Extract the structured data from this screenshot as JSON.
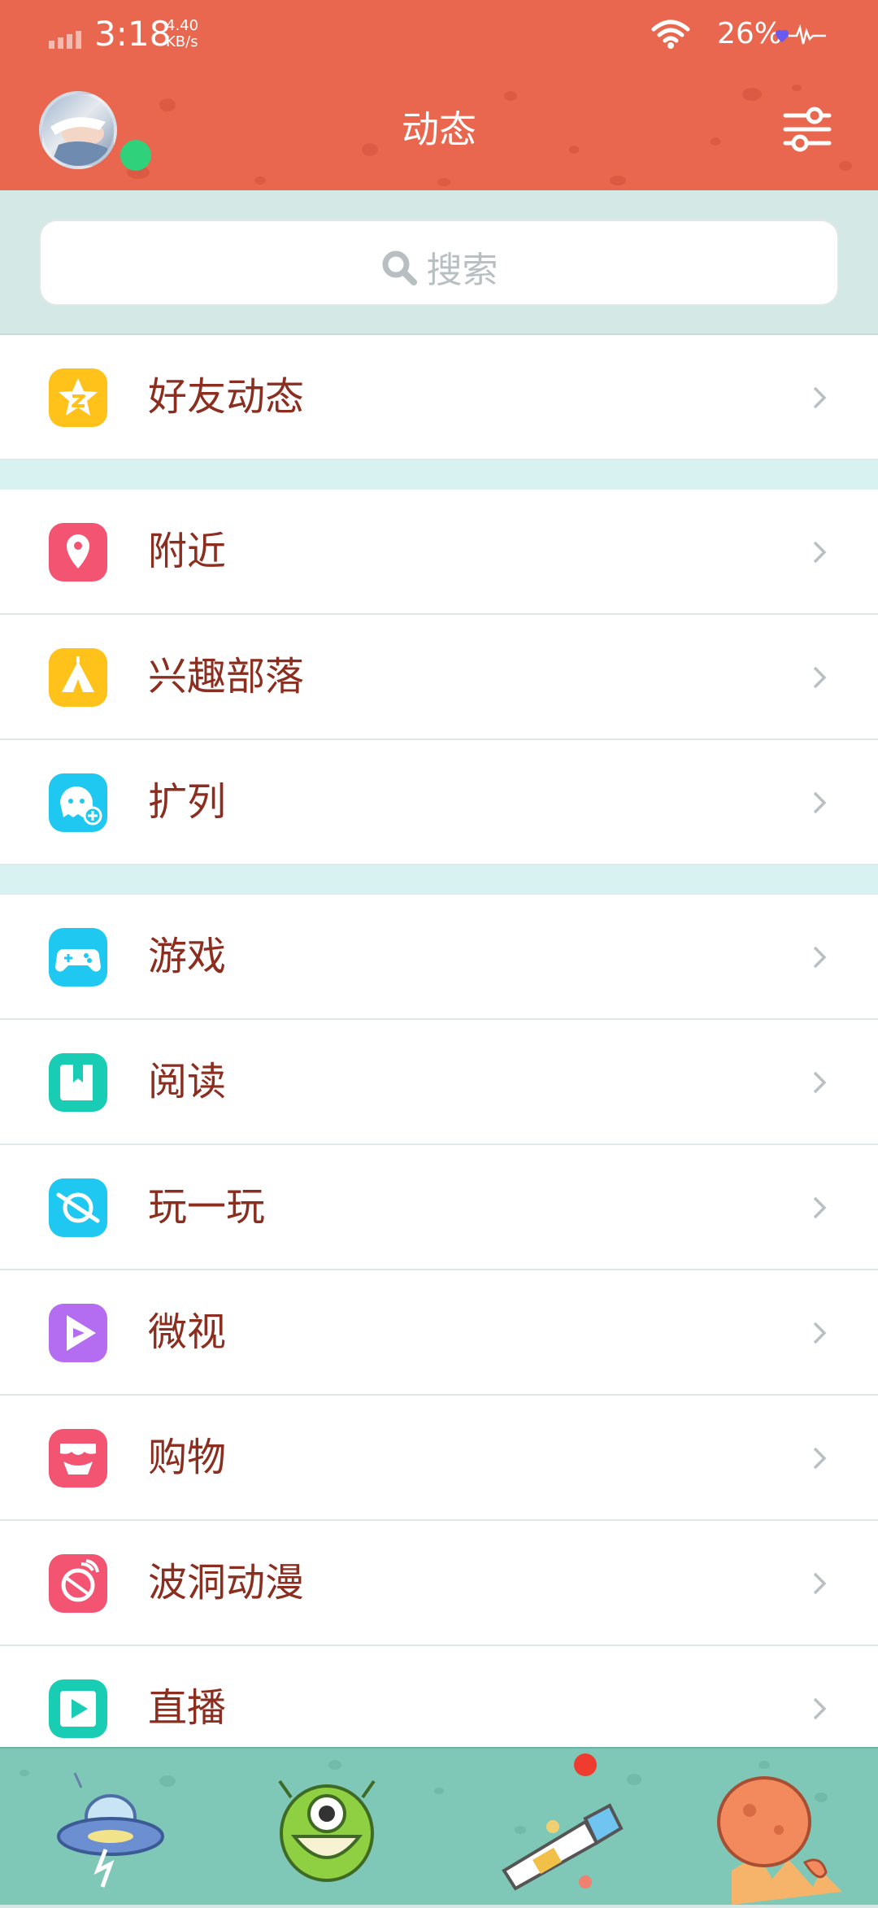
{
  "status_bar": {
    "time": "3:18",
    "net_speed_value": "4.40",
    "net_speed_unit": "KB/s",
    "battery": "26%"
  },
  "header": {
    "title": "动态"
  },
  "search": {
    "placeholder": "搜索"
  },
  "menu_groups": [
    {
      "items": [
        {
          "label": "好友动态",
          "icon": "qzone-star-icon",
          "color": "#ffc21a"
        }
      ]
    },
    {
      "items": [
        {
          "label": "附近",
          "icon": "location-pin-icon",
          "color": "#f25472"
        },
        {
          "label": "兴趣部落",
          "icon": "tent-icon",
          "color": "#ffc21a"
        },
        {
          "label": "扩列",
          "icon": "add-friend-icon",
          "color": "#1fc8f0"
        }
      ]
    },
    {
      "items": [
        {
          "label": "游戏",
          "icon": "gamepad-icon",
          "color": "#1fc8f0"
        },
        {
          "label": "阅读",
          "icon": "book-icon",
          "color": "#19cdb4"
        },
        {
          "label": "玩一玩",
          "icon": "planet-icon",
          "color": "#1fc8f0"
        },
        {
          "label": "微视",
          "icon": "play-video-icon",
          "color": "#b46cf0"
        },
        {
          "label": "购物",
          "icon": "shopping-bag-icon",
          "color": "#f25472"
        },
        {
          "label": "波洞动漫",
          "icon": "comic-icon",
          "color": "#f25472"
        },
        {
          "label": "直播",
          "icon": "live-icon",
          "color": "#19cdb4"
        }
      ]
    }
  ],
  "colors": {
    "accent": "#e9664f",
    "label_text": "#8b2e1f",
    "separator": "#d8f1f1",
    "bottom_bar": "#7fc8b8",
    "online": "#2fd27a",
    "notification": "#f03c2e"
  },
  "bottom_tabs": [
    {
      "icon": "ufo-icon"
    },
    {
      "icon": "alien-monster-icon"
    },
    {
      "icon": "telescope-icon"
    },
    {
      "icon": "meteor-planet-icon"
    }
  ]
}
